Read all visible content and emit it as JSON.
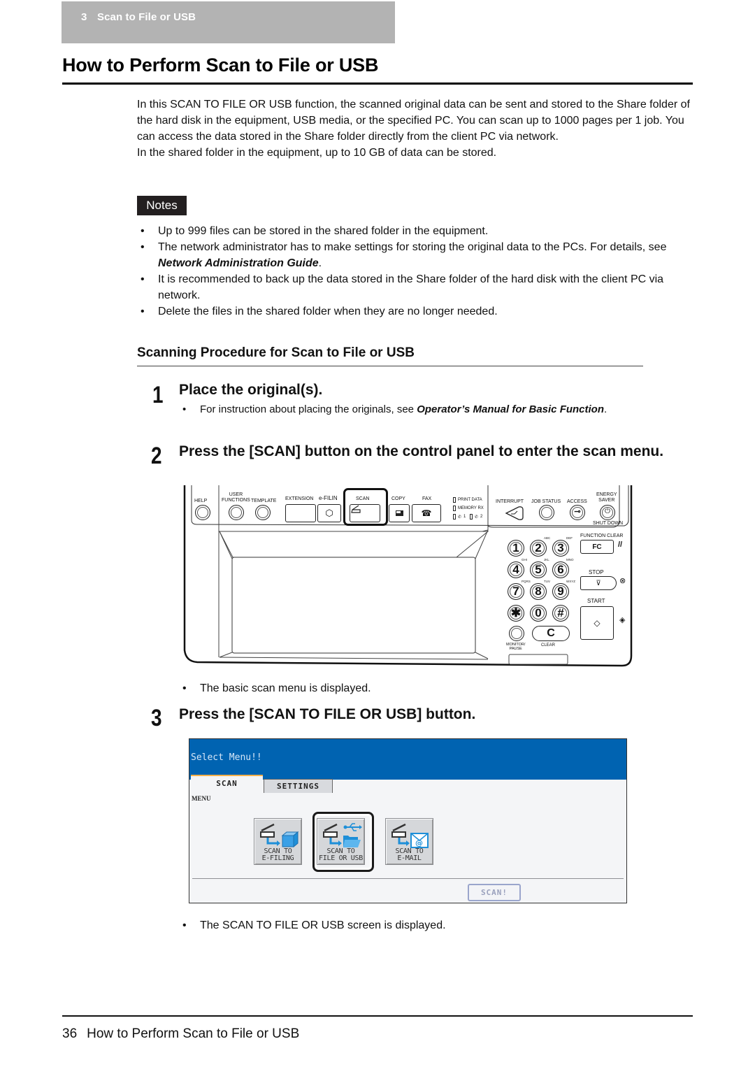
{
  "header": {
    "chapter_number": "3",
    "chapter_title": "Scan to File or USB"
  },
  "page_title": "How to Perform Scan to File or USB",
  "intro": {
    "paragraph1": "In this SCAN TO FILE OR USB function, the scanned original data can be sent and stored to the Share folder of the hard disk in the equipment, USB media, or the specified PC. You can scan up to 1000 pages per 1 job. You can access the data stored in the Share folder directly from the client PC via network.",
    "paragraph2": "In the shared folder in the equipment, up to 10 GB of data can be stored."
  },
  "notes": {
    "badge": "Notes",
    "items": [
      {
        "text": "Up to 999 files can be stored in the shared folder in the equipment."
      },
      {
        "text": "The network administrator has to make settings for storing the original data to the PCs. For details, see ",
        "ref": "Network Administration Guide",
        "after": "."
      },
      {
        "text": "It is recommended to back up the data stored in the Share folder of the hard disk with the client PC via network."
      },
      {
        "text": "Delete the files in the shared folder when they are no longer needed."
      }
    ]
  },
  "procedure": {
    "heading": "Scanning Procedure for Scan to File or USB",
    "steps": [
      {
        "number": "1",
        "title": "Place the original(s).",
        "bullet_text": "For instruction about placing the originals, see ",
        "bullet_ref": "Operator’s Manual for Basic Function",
        "bullet_after": "."
      },
      {
        "number": "2",
        "title": "Press the [SCAN] button on the control panel to enter the scan menu.",
        "result": "The basic scan menu is displayed."
      },
      {
        "number": "3",
        "title": "Press the [SCAN TO FILE OR USB] button.",
        "result": "The SCAN TO FILE OR USB screen is displayed."
      }
    ]
  },
  "control_panel": {
    "help": "HELP",
    "user_functions": "USER\nFUNCTIONS",
    "template": "TEMPLATE",
    "extension": "EXTENSION",
    "efiling": "e-FILIN",
    "scan": "SCAN",
    "copy": "COPY",
    "fax": "FAX",
    "leds": {
      "print_data": "PRINT DATA",
      "memory_rx": "MEMORY RX",
      "line1": "1",
      "line2": "2"
    },
    "interrupt": "INTERRUPT",
    "job_status": "JOB STATUS",
    "access": "ACCESS",
    "energy_saver": "ENERGY\nSAVER",
    "shut_down": "SHUT DOWN",
    "function_clear": "FUNCTION CLEAR",
    "fc": "FC",
    "stop": "STOP",
    "start": "START",
    "monitor_pause": "MONITOR/\nPAUSE",
    "clear": "CLEAR",
    "clear_key": "C",
    "keypad": [
      {
        "key": "1",
        "sub": ""
      },
      {
        "key": "2",
        "sub": "ABC"
      },
      {
        "key": "3",
        "sub": "DEF"
      },
      {
        "key": "4",
        "sub": "GHI"
      },
      {
        "key": "5",
        "sub": "JKL"
      },
      {
        "key": "6",
        "sub": "MNO"
      },
      {
        "key": "7",
        "sub": "PQRS"
      },
      {
        "key": "8",
        "sub": "TUV"
      },
      {
        "key": "9",
        "sub": "WXYZ"
      },
      {
        "key": "✱",
        "sub": ""
      },
      {
        "key": "0",
        "sub": ""
      },
      {
        "key": "#",
        "sub": ""
      }
    ]
  },
  "touch_panel": {
    "title": "Select Menu!!",
    "tabs": [
      {
        "label": "SCAN",
        "active": true
      },
      {
        "label": "SETTINGS",
        "active": false
      }
    ],
    "menu_label": "MENU",
    "buttons": [
      {
        "line1": "SCAN TO",
        "line2": "E-FILING",
        "icon": "scan-to-efiling-icon"
      },
      {
        "line1": "SCAN TO",
        "line2": "FILE OR USB",
        "icon": "scan-to-file-usb-icon",
        "highlighted": true
      },
      {
        "line1": "SCAN TO",
        "line2": "E-MAIL",
        "icon": "scan-to-email-icon"
      }
    ],
    "scan_button": "SCAN!",
    "colors": {
      "header": "#0063b1",
      "body": "#f4f5f7",
      "tab_accent": "#f4b04a",
      "icon_blue": "#1e8fd8"
    }
  },
  "footer": {
    "page_number": "36",
    "title": "How to Perform Scan to File or USB"
  }
}
